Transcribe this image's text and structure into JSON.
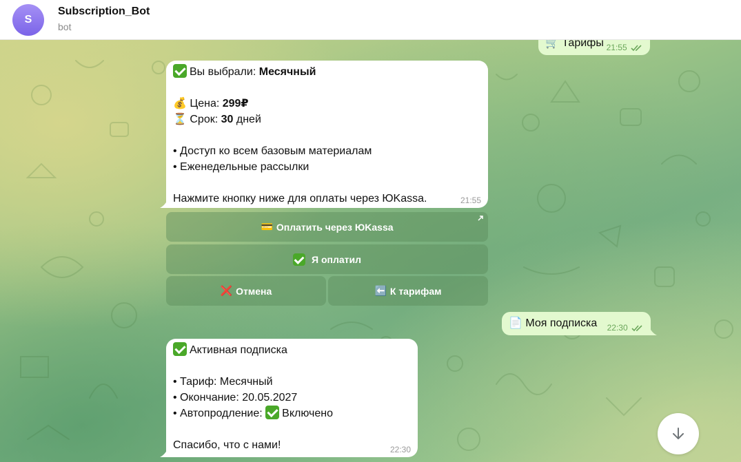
{
  "header": {
    "avatar_letter": "S",
    "title": "Subscription_Bot",
    "subtitle": "bot"
  },
  "messages": {
    "tariffs_cmd": {
      "emoji": "🛒",
      "text": "Тарифы",
      "time": "21:55"
    },
    "plan": {
      "line1_prefix": "Вы выбрали: ",
      "line1_bold": "Месячный",
      "price_emoji": "💰",
      "price_label": "Цена: ",
      "price_value": "299₽",
      "term_emoji": "⏳",
      "term_label": "Срок: ",
      "term_value": "30",
      "term_unit": " дней",
      "feature1": "• Доступ ко всем базовым материалам",
      "feature2": "• Еженедельные рассылки",
      "footer": "Нажмите кнопку ниже для оплаты через ЮKassa.",
      "time": "21:55"
    },
    "my_sub_cmd": {
      "emoji": "📄",
      "text": "Моя подписка",
      "time": "22:30"
    },
    "status": {
      "line1": "Активная подписка",
      "tariff": "• Тариф: Месячный",
      "end": "• Окончание: 20.05.2027",
      "auto_prefix": "• Автопродление: ",
      "auto_value": "Включено",
      "thanks": "Спасибо, что с нами!",
      "time": "22:30"
    }
  },
  "keyboard": {
    "pay": {
      "emoji": "💳",
      "label": "Оплатить через ЮKassa"
    },
    "paid": {
      "label": "Я оплатил"
    },
    "cancel": {
      "emoji": "❌",
      "label": "Отмена"
    },
    "back": {
      "emoji": "⬅️",
      "label": "К тарифам"
    }
  },
  "colors": {
    "accent": "#7b64e8",
    "outgoing": "#e3f9cf",
    "check_green": "#4aa829",
    "tick_green": "#6aa65a"
  },
  "icons": [
    "scroll-down-icon",
    "double-check-icon",
    "external-link-icon"
  ]
}
